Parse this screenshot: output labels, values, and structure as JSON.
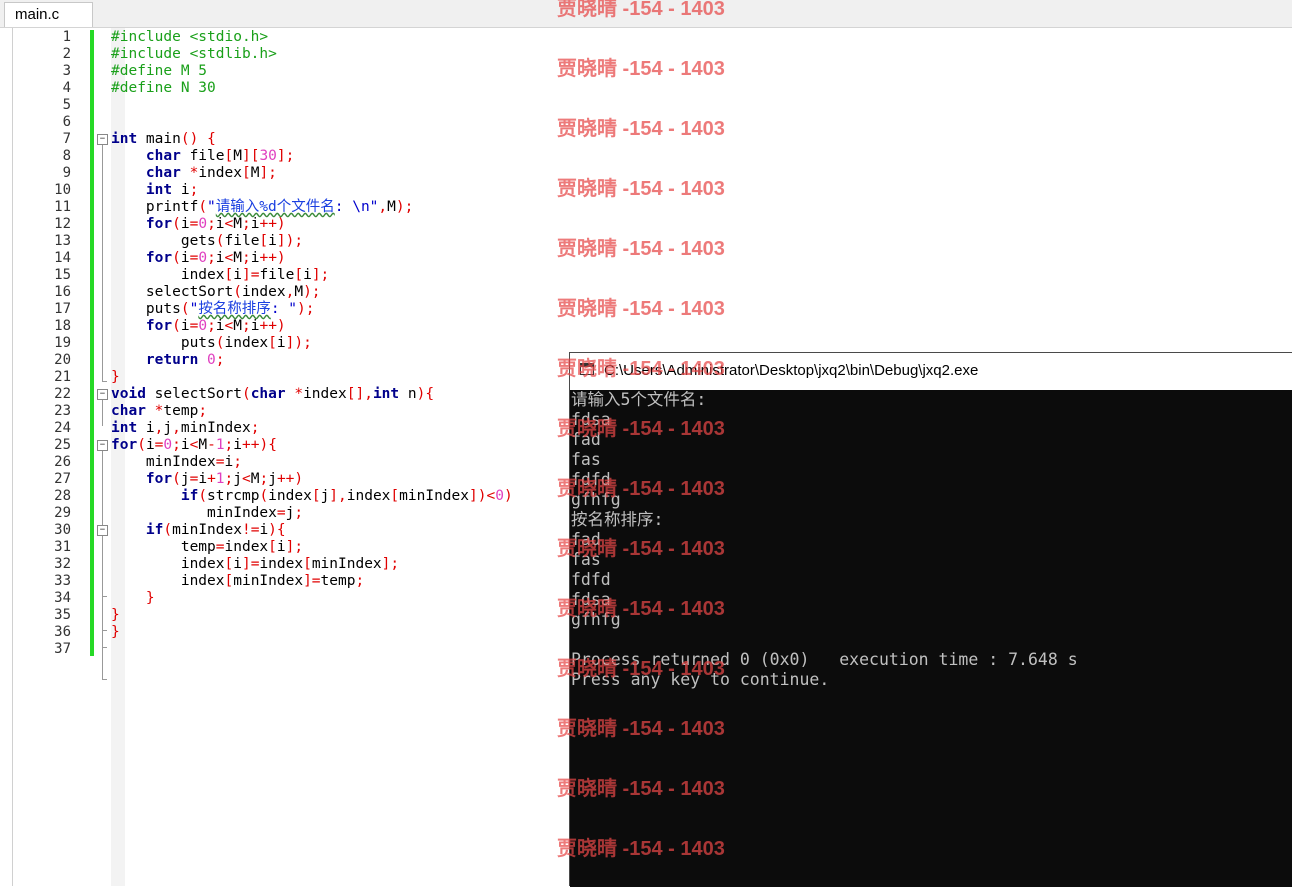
{
  "tab": {
    "label": "main.c"
  },
  "editor": {
    "line_numbers": [
      "1",
      "2",
      "3",
      "4",
      "5",
      "6",
      "7",
      "8",
      "9",
      "10",
      "11",
      "12",
      "13",
      "14",
      "15",
      "16",
      "17",
      "18",
      "19",
      "20",
      "21",
      "22",
      "23",
      "24",
      "25",
      "26",
      "27",
      "28",
      "29",
      "30",
      "31",
      "32",
      "33",
      "34",
      "35",
      "36",
      "37"
    ]
  },
  "console": {
    "title": "C:\\Users\\Administrator\\Desktop\\jxq2\\bin\\Debug\\jxq2.exe",
    "lines": [
      "请输入5个文件名:",
      "fdsa",
      "fad",
      "fas",
      "fdfd",
      "gfhfg",
      "按名称排序:",
      "fad",
      "fas",
      "fdfd",
      "fdsa",
      "gfhfg",
      "",
      "Process returned 0 (0x0)   execution time : 7.648 s",
      "Press any key to continue."
    ]
  },
  "watermark": {
    "text": "贾晓晴 -154 - 1403"
  }
}
